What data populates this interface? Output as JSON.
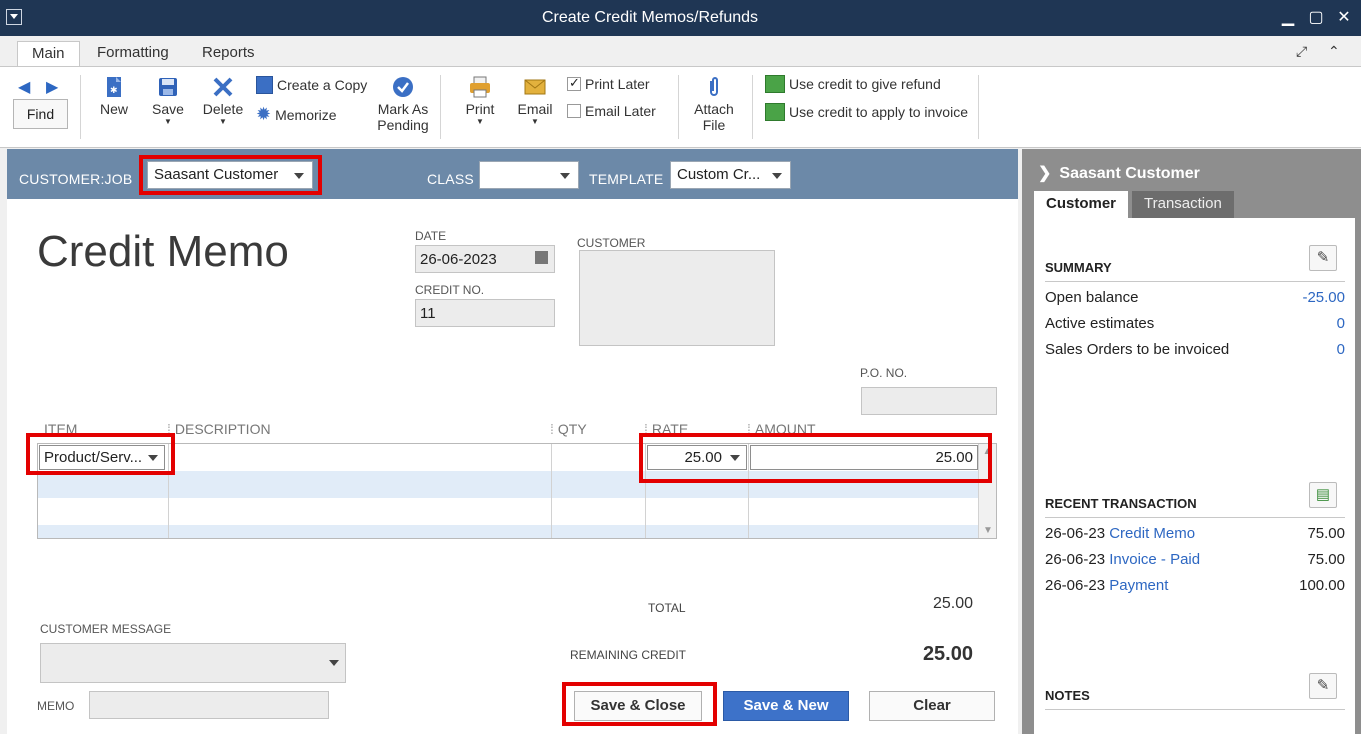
{
  "window": {
    "title": "Create Credit Memos/Refunds"
  },
  "tabs": [
    {
      "label": "Main"
    },
    {
      "label": "Formatting"
    },
    {
      "label": "Reports"
    }
  ],
  "ribbon": {
    "find": "Find",
    "new": "New",
    "save": "Save",
    "delete": "Delete",
    "create_copy": "Create a Copy",
    "memorize": "Memorize",
    "mark_as_pending_1": "Mark As",
    "mark_as_pending_2": "Pending",
    "print": "Print",
    "email": "Email",
    "print_later": "Print Later",
    "email_later": "Email Later",
    "attach_1": "Attach",
    "attach_2": "File",
    "use_credit_refund": "Use credit to give refund",
    "use_credit_invoice": "Use credit to apply to invoice"
  },
  "header": {
    "customer_job_label": "CUSTOMER:JOB",
    "customer_job_value": "Saasant Customer",
    "class_label": "CLASS",
    "class_value": "",
    "template_label": "TEMPLATE",
    "template_value": "Custom Cr..."
  },
  "form": {
    "title": "Credit Memo",
    "date_label": "DATE",
    "date_value": "26-06-2023",
    "credit_no_label": "CREDIT NO.",
    "credit_no_value": "11",
    "customer_label": "CUSTOMER",
    "po_label": "P.O. NO.",
    "columns": [
      "ITEM",
      "DESCRIPTION",
      "QTY",
      "RATE",
      "AMOUNT"
    ],
    "line": {
      "item": "Product/Serv...",
      "description": "",
      "qty": "",
      "rate": "25.00",
      "amount": "25.00"
    },
    "customer_message_label": "CUSTOMER MESSAGE",
    "memo_label": "MEMO",
    "total_label": "TOTAL",
    "total_value": "25.00",
    "remaining_label": "REMAINING CREDIT",
    "remaining_value": "25.00"
  },
  "buttons": {
    "save_close": "Save & Close",
    "save_new": "Save & New",
    "clear": "Clear"
  },
  "side": {
    "title": "Saasant Customer",
    "tab_customer": "Customer",
    "tab_transaction": "Transaction",
    "summary_title": "SUMMARY",
    "summary": [
      {
        "label": "Open balance",
        "value": "-25.00"
      },
      {
        "label": "Active estimates",
        "value": "0"
      },
      {
        "label": "Sales Orders to be invoiced",
        "value": "0"
      }
    ],
    "recent_title": "RECENT TRANSACTION",
    "recent": [
      {
        "date": "26-06-23",
        "type": "Credit Memo",
        "amount": "75.00"
      },
      {
        "date": "26-06-23",
        "type": "Invoice - Paid",
        "amount": "75.00"
      },
      {
        "date": "26-06-23",
        "type": "Payment",
        "amount": "100.00"
      }
    ],
    "notes_title": "NOTES"
  },
  "colors": {
    "titlebar": "#1f3654",
    "headbar": "#6c89a8",
    "highlight": "#e30000",
    "link": "#2d67c2",
    "primary_button": "#3d72c9"
  }
}
